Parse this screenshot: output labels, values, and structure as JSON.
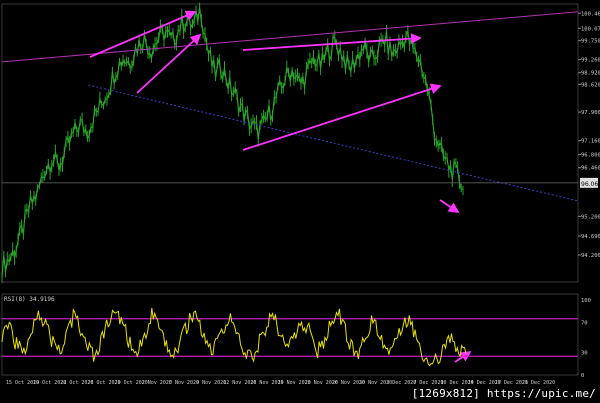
{
  "chart_data": [
    {
      "type": "line",
      "panel": "price",
      "ylim": [
        93.5,
        100.7
      ],
      "y_ticks": [
        "100.460",
        "100.070",
        "99.750",
        "99.260",
        "98.920",
        "98.620",
        "97.900",
        "97.160",
        "96.800",
        "96.460",
        "95.200",
        "94.690",
        "94.200"
      ],
      "current_price_label": "96.068",
      "current_price": 96.068,
      "series_color": "#29a329",
      "series": [
        {
          "values": [
            93.9,
            94.1,
            94.4,
            94.9,
            95.5,
            95.8,
            96.4,
            96.7,
            96.5,
            96.9,
            97.3,
            97.6,
            97.4,
            97.8,
            98.1,
            98.5,
            99.0,
            99.3,
            99.2,
            99.6,
            99.8,
            99.5,
            99.8,
            100.0,
            99.7,
            100.1,
            100.3,
            100.1,
            100.6,
            99.5,
            98.9,
            99.1,
            98.6,
            98.3,
            97.9,
            97.6,
            97.4,
            97.6,
            98.0,
            98.4,
            98.8,
            99.0,
            98.6,
            98.9,
            99.3,
            99.1,
            99.5,
            99.7,
            99.4,
            99.0,
            99.3,
            99.6,
            99.2,
            99.5,
            99.8,
            99.4,
            99.6,
            99.9,
            99.5,
            99.2,
            98.5,
            97.4,
            96.8,
            96.5,
            96.3,
            96.0
          ]
        }
      ],
      "trendlines": [
        {
          "name": "upper-channel",
          "color": "#b030b0",
          "from": [
            0,
            99.2
          ],
          "to": [
            80,
            100.5
          ]
        },
        {
          "name": "lower-support",
          "color": "#3c3cc8",
          "from": [
            12,
            98.6
          ],
          "to": [
            80,
            95.6
          ]
        }
      ],
      "annotation_arrows": 6
    },
    {
      "type": "line",
      "panel": "indicator",
      "label": "RSI(8) 34.9196",
      "ylim": [
        0,
        100
      ],
      "y_ticks": [
        "100",
        "70",
        "30",
        "0"
      ],
      "levels": [
        75,
        25
      ],
      "series_color": "#e8e000",
      "series": [
        {
          "values": [
            55,
            72,
            40,
            28,
            60,
            85,
            70,
            45,
            30,
            52,
            78,
            62,
            35,
            24,
            48,
            70,
            88,
            65,
            40,
            30,
            55,
            80,
            60,
            38,
            26,
            45,
            68,
            82,
            58,
            34,
            40,
            62,
            76,
            50,
            28,
            22,
            44,
            66,
            80,
            55,
            36,
            48,
            72,
            58,
            30,
            42,
            70,
            84,
            60,
            38,
            30,
            52,
            74,
            56,
            32,
            46,
            68,
            78,
            50,
            28,
            20,
            18,
            35,
            48,
            30,
            34.9
          ]
        }
      ]
    }
  ],
  "x_ticks": [
    "15 Oct 2020",
    "19 Oct 2020",
    "22 Oct 2020",
    "26 Oct 2020",
    "29 Oct 2020",
    "2 Nov 2020",
    "5 Nov 2020",
    "9 Nov 2020",
    "12 Nov 2020",
    "16 Nov 2020",
    "19 Nov 2020",
    "23 Nov 2020",
    "26 Nov 2020",
    "30 Nov 2020",
    "3 Dec 2020",
    "7 Dec 2020",
    "10 Dec 2020",
    "14 Dec 2020",
    "17 Dec 2020",
    "21 Dec 2020"
  ],
  "watermark": "[1269x812] https://upic.me/"
}
